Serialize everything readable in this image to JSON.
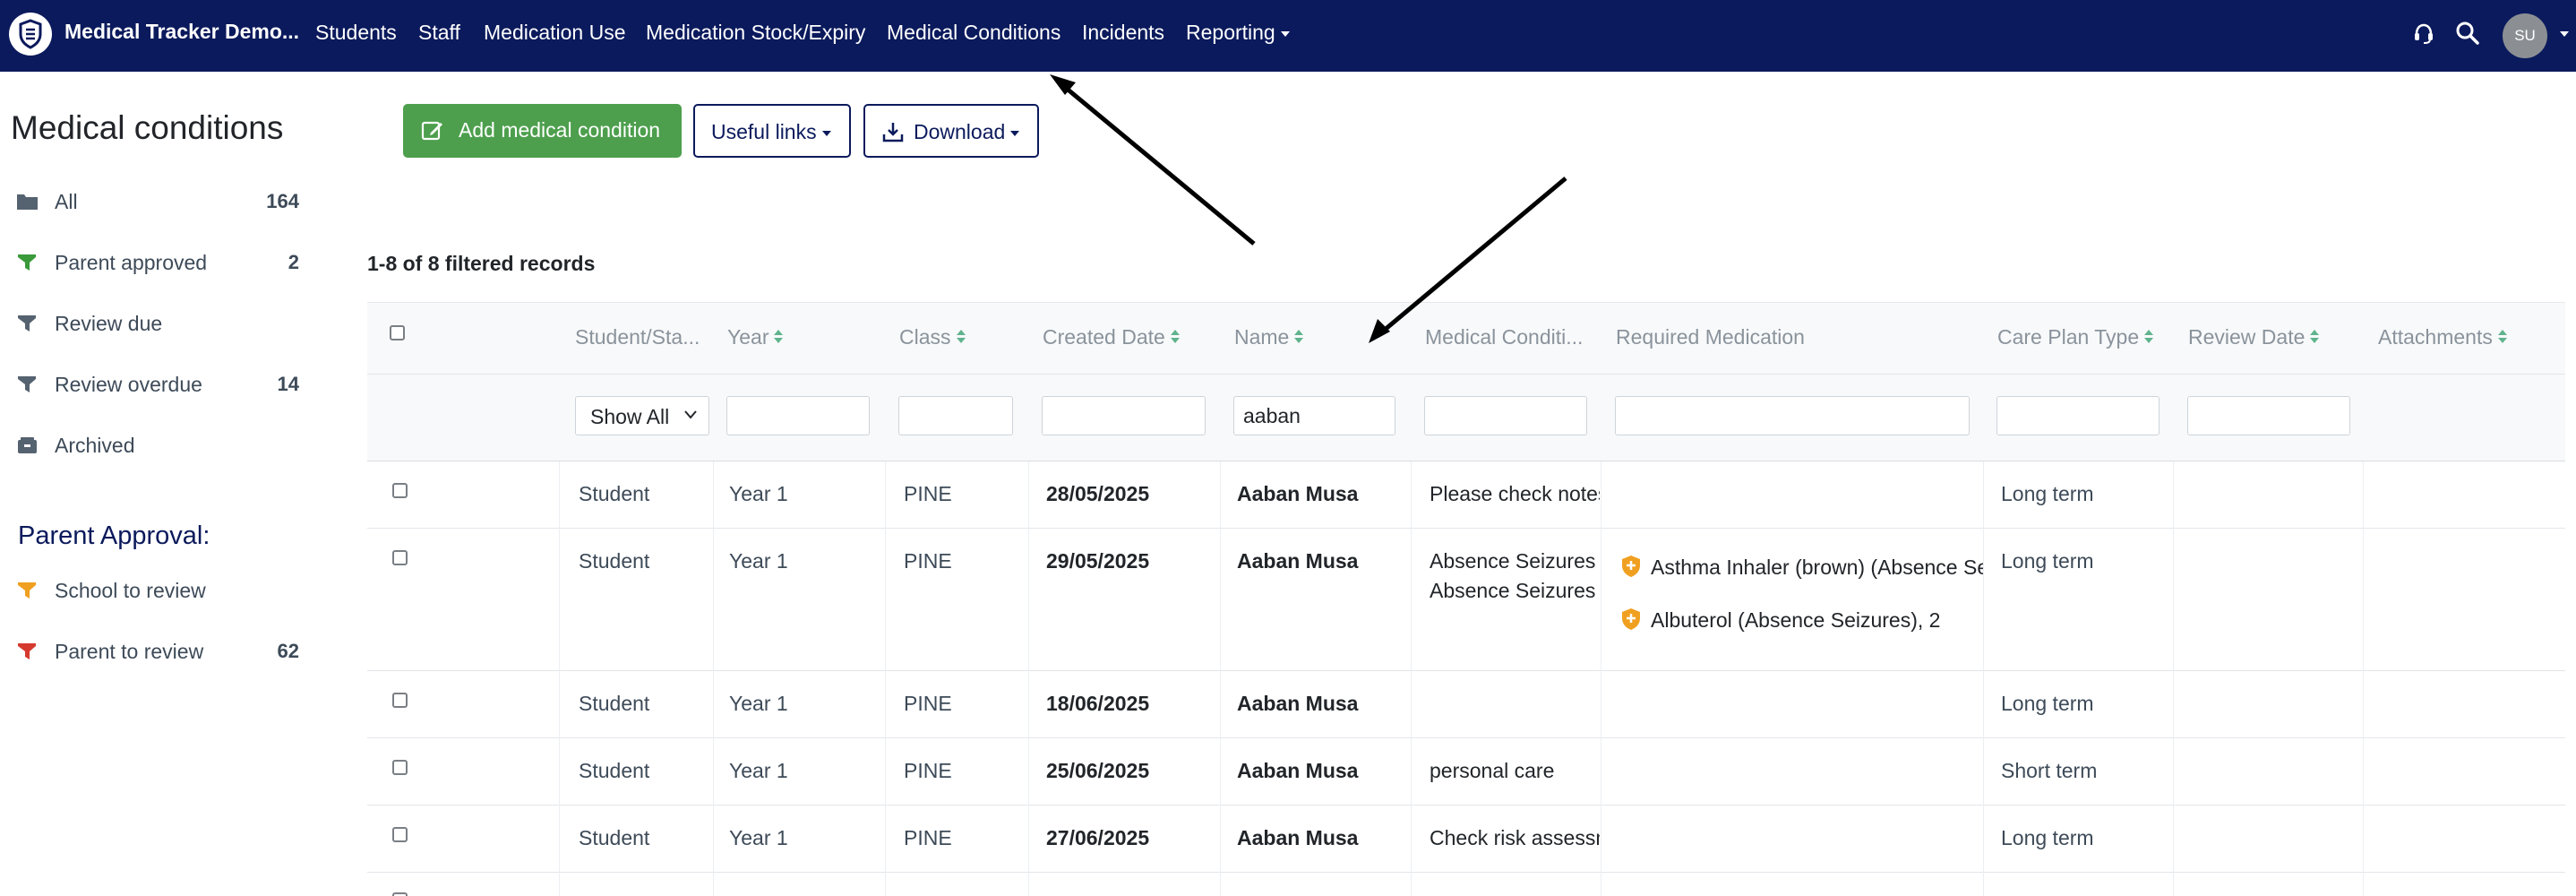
{
  "app": {
    "brand": "Medical Tracker Demo...",
    "nav": [
      "Students",
      "Staff",
      "Medication Use",
      "Medication Stock/Expiry",
      "Medical Conditions",
      "Incidents",
      "Reporting"
    ],
    "user_initials": "SU",
    "icons": [
      "support-icon",
      "search-icon"
    ]
  },
  "sidebar": {
    "title": "Medical conditions",
    "items": [
      {
        "label": "All",
        "count": "164",
        "icon": "folder-icon"
      },
      {
        "label": "Parent approved",
        "count": "2",
        "icon": "filter-icon"
      },
      {
        "label": "Review due",
        "count": "",
        "icon": "filter-icon"
      },
      {
        "label": "Review overdue",
        "count": "14",
        "icon": "filter-icon"
      },
      {
        "label": "Archived",
        "count": "",
        "icon": "archive-icon"
      }
    ],
    "section_title": "Parent Approval:",
    "approval_items": [
      {
        "label": "School to review",
        "count": "",
        "icon": "filter-icon"
      },
      {
        "label": "Parent to review",
        "count": "62",
        "icon": "filter-icon"
      }
    ]
  },
  "toolbar": {
    "add_label": "Add medical condition",
    "links_label": "Useful links",
    "download_label": "Download"
  },
  "records_label": "1-8 of 8 filtered records",
  "table": {
    "headers": [
      "Student/Sta...",
      "Year",
      "Class",
      "Created Date",
      "Name",
      "Medical Conditi...",
      "Required Medication",
      "Care Plan Type",
      "Review Date",
      "Attachments"
    ],
    "filters": {
      "type_select": "Show All",
      "name": "aaban"
    },
    "rows": [
      {
        "type": "Student",
        "year": "Year 1",
        "class": "PINE",
        "created": "28/05/2025",
        "name": "Aaban Musa",
        "conditions": [
          "Please check notes"
        ],
        "medications": [],
        "care_plan": "Long term"
      },
      {
        "type": "Student",
        "year": "Year 1",
        "class": "PINE",
        "created": "29/05/2025",
        "name": "Aaban Musa",
        "conditions": [
          "Absence Seizures",
          "Absence Seizures"
        ],
        "medications": [
          "Asthma Inhaler (brown) (Absence Seizures)",
          "Albuterol (Absence Seizures), 2"
        ],
        "care_plan": "Long term"
      },
      {
        "type": "Student",
        "year": "Year 1",
        "class": "PINE",
        "created": "18/06/2025",
        "name": "Aaban Musa",
        "conditions": [],
        "medications": [],
        "care_plan": "Long term"
      },
      {
        "type": "Student",
        "year": "Year 1",
        "class": "PINE",
        "created": "25/06/2025",
        "name": "Aaban Musa",
        "conditions": [
          "personal care"
        ],
        "medications": [],
        "care_plan": "Short term"
      },
      {
        "type": "Student",
        "year": "Year 1",
        "class": "PINE",
        "created": "27/06/2025",
        "name": "Aaban Musa",
        "conditions": [
          "Check risk assessment"
        ],
        "medications": [],
        "care_plan": "Long term"
      }
    ]
  },
  "colors": {
    "nav_bg": "#0b1a5c",
    "success": "#4d9f4d",
    "sort_arrow": "#5fb38d",
    "approved_filter": "#3a9a3a",
    "school_review_filter": "#f0a020",
    "parent_review_filter": "#d63a2f",
    "shield_badge": "#f0a020"
  }
}
